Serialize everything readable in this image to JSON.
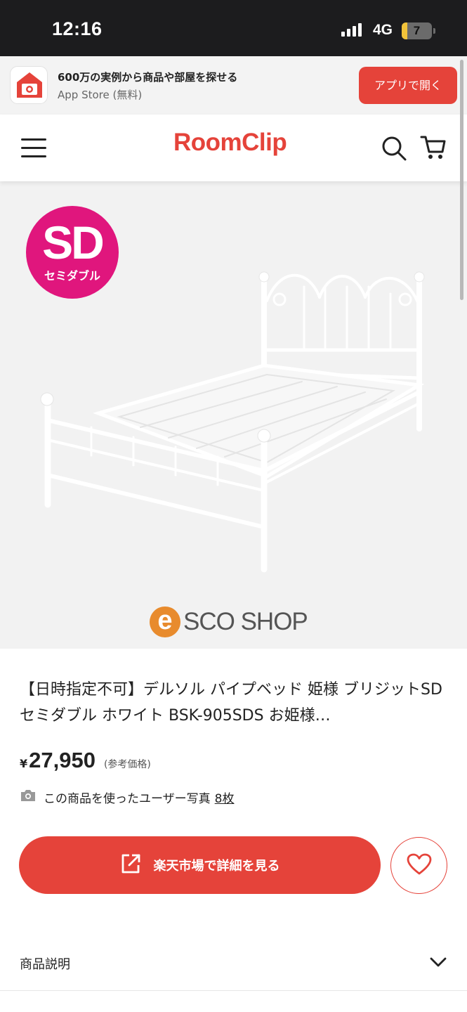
{
  "status_bar": {
    "time": "12:16",
    "network": "4G",
    "battery": "7",
    "battery_level": 0.18
  },
  "app_banner": {
    "icon": "roomclip-app-icon",
    "title": "600万の実例から商品や部屋を探せる",
    "subtitle": "App Store (無料)",
    "open_button": "アプリで開く"
  },
  "header": {
    "logo": "RoomClip",
    "menu_icon": "hamburger-menu-icon",
    "search_icon": "search-icon",
    "cart_icon": "cart-icon"
  },
  "product_image": {
    "badge_big": "SD",
    "badge_small": "セミダブル",
    "shop_logo_letter": "e",
    "shop_logo_text": "SCO SHOP"
  },
  "product": {
    "title": "【日時指定不可】デルソル パイプベッド 姫様 ブリジットSD セミダブル ホワイト BSK-905SDS お姫様…",
    "currency": "¥",
    "price": "27,950",
    "price_note": "(参考価格)",
    "photos_label": "この商品を使ったユーザー写真",
    "photos_count": "8枚"
  },
  "actions": {
    "rakuten_button": "楽天市場で詳細を見る",
    "favorite_icon": "heart-icon"
  },
  "description": {
    "label": "商品説明"
  },
  "colors": {
    "accent": "#e5433a",
    "badge": "#e0167d",
    "shop_logo": "#e88b2d"
  }
}
